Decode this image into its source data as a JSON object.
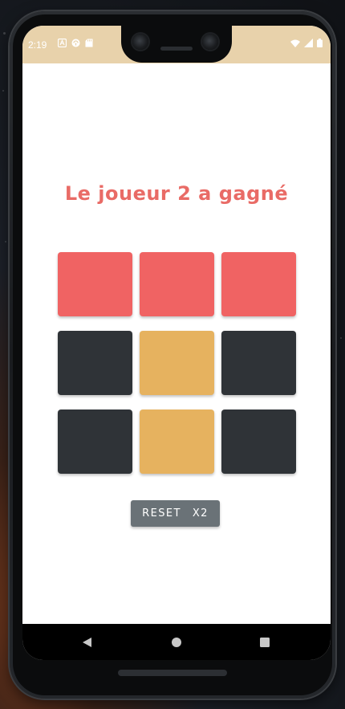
{
  "status_bar": {
    "time": "2:19",
    "background": "#e8d2ab",
    "left_icons": [
      "a-box-icon",
      "sync-icon",
      "sd-card-icon"
    ],
    "right_icons": [
      "wifi-icon",
      "signal-icon",
      "battery-icon"
    ]
  },
  "game": {
    "winner_message": "Le joueur 2 a gagné",
    "winner_color": "#e96b66",
    "cells": [
      {
        "owner": "player-2",
        "color": "#f06363"
      },
      {
        "owner": "player-2",
        "color": "#f06363"
      },
      {
        "owner": "player-2",
        "color": "#f06363"
      },
      {
        "owner": "empty",
        "color": "#2f3337"
      },
      {
        "owner": "player-1",
        "color": "#e6b25f"
      },
      {
        "owner": "empty",
        "color": "#2f3337"
      },
      {
        "owner": "empty",
        "color": "#2f3337"
      },
      {
        "owner": "player-1",
        "color": "#e6b25f"
      },
      {
        "owner": "empty",
        "color": "#2f3337"
      }
    ]
  },
  "reset_button": {
    "label": "RESET",
    "multiplier": "X2",
    "background": "#6a7277"
  },
  "nav_bar": {
    "buttons": [
      "back-icon",
      "home-icon",
      "recents-icon"
    ]
  }
}
